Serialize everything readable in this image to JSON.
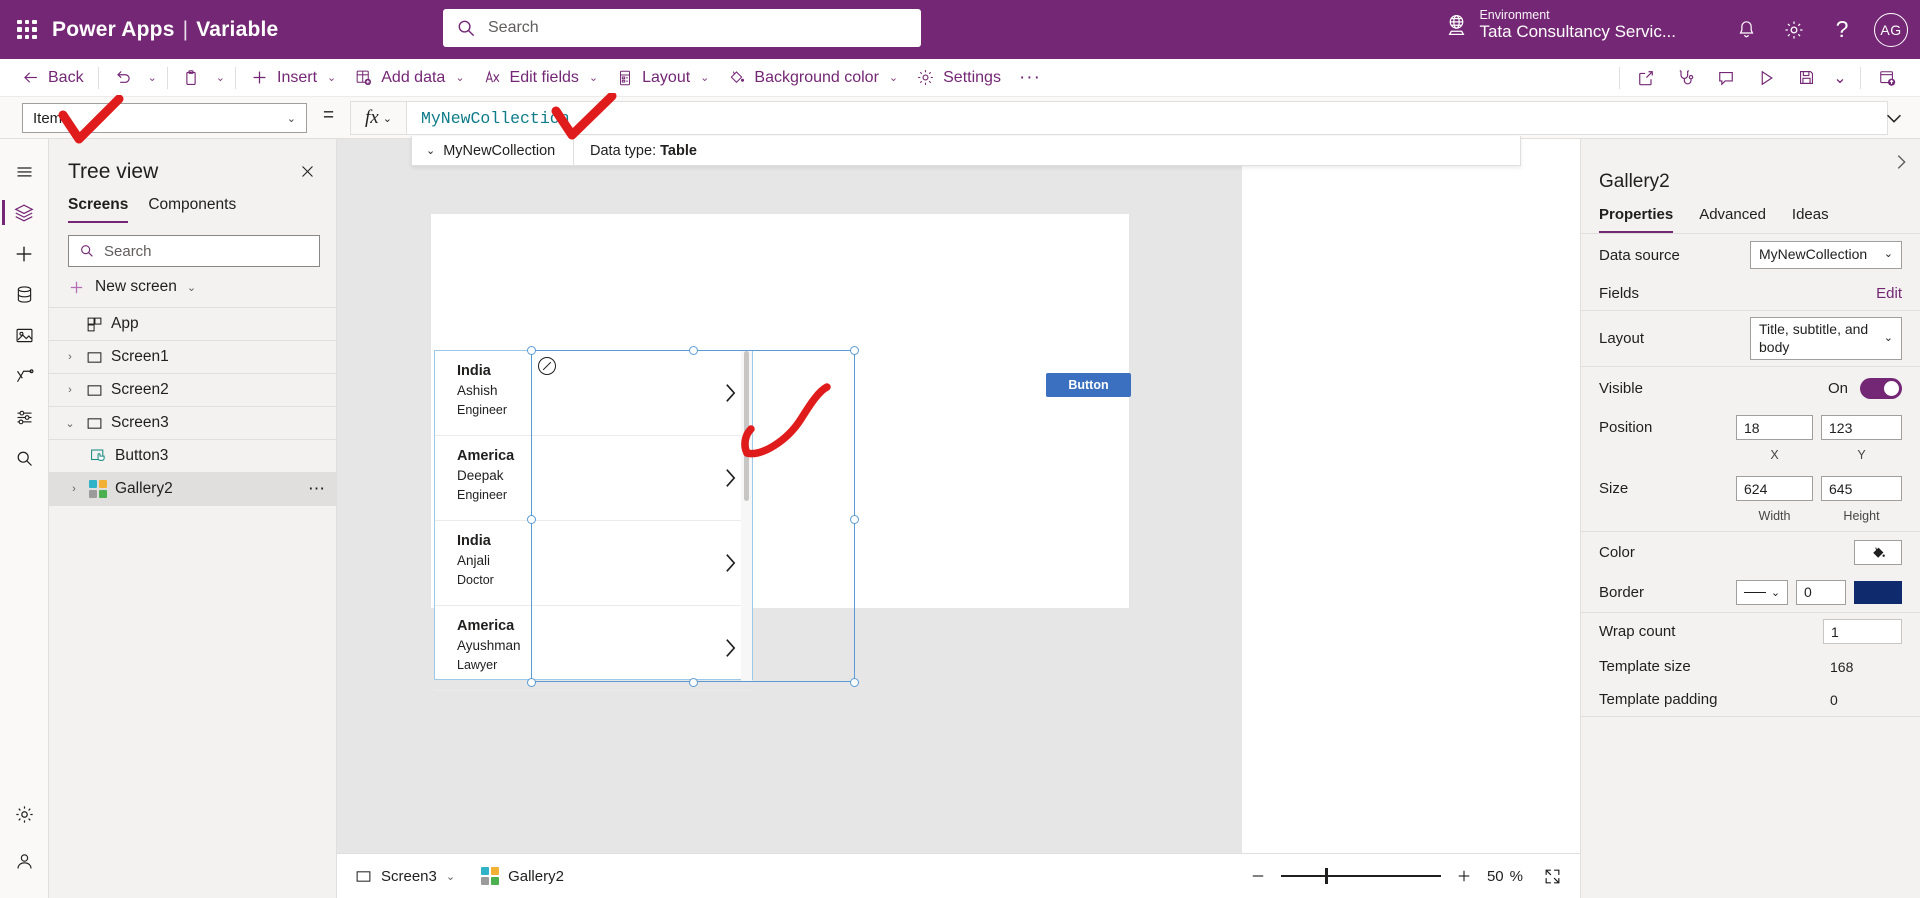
{
  "header": {
    "brand": "Power Apps",
    "separator": "|",
    "app_name": "Variable",
    "search_placeholder": "Search",
    "environment_label": "Environment",
    "environment_name": "Tata Consultancy Servic...",
    "avatar_initials": "AG",
    "accent_color": "#742774"
  },
  "commandbar": {
    "back": "Back",
    "insert": "Insert",
    "add_data": "Add data",
    "edit_fields": "Edit fields",
    "layout": "Layout",
    "background_color": "Background color",
    "settings": "Settings",
    "overflow": "···"
  },
  "formulabar": {
    "property": "Items",
    "equals": "=",
    "fx": "fx",
    "expression": "MyNewCollection",
    "expression_color": "#0f7c8a",
    "suggestion_name": "MyNewCollection",
    "datatype_label": "Data type:",
    "datatype_value": "Table"
  },
  "treeview": {
    "title": "Tree view",
    "tabs": [
      {
        "label": "Screens",
        "selected": true
      },
      {
        "label": "Components",
        "selected": false
      }
    ],
    "search_placeholder": "Search",
    "new_screen": "New screen",
    "items": [
      {
        "label": "App",
        "icon": "app-icon",
        "indent": 1,
        "caret": "",
        "selected": false
      },
      {
        "label": "Screen1",
        "icon": "screen-icon",
        "indent": 1,
        "caret": "›",
        "selected": false
      },
      {
        "label": "Screen2",
        "icon": "screen-icon",
        "indent": 1,
        "caret": "›",
        "selected": false
      },
      {
        "label": "Screen3",
        "icon": "screen-icon",
        "indent": 1,
        "caret": "⌄",
        "selected": false
      },
      {
        "label": "Button3",
        "icon": "button-icon",
        "indent": 2,
        "caret": "",
        "selected": false
      },
      {
        "label": "Gallery2",
        "icon": "gallery-icon",
        "indent": 2,
        "caret": "›",
        "selected": true,
        "overflow": "⋯"
      }
    ]
  },
  "canvas": {
    "button_label": "Button",
    "gallery_items": [
      {
        "title": "India",
        "subtitle": "Ashish",
        "body": "Engineer"
      },
      {
        "title": "America",
        "subtitle": "Deepak",
        "body": "Engineer"
      },
      {
        "title": "India",
        "subtitle": "Anjali",
        "body": "Doctor"
      },
      {
        "title": "America",
        "subtitle": "Ayushman",
        "body": "Lawyer"
      }
    ]
  },
  "properties": {
    "control_name": "Gallery2",
    "tabs": [
      {
        "label": "Properties",
        "selected": true
      },
      {
        "label": "Advanced",
        "selected": false
      },
      {
        "label": "Ideas",
        "selected": false
      }
    ],
    "data_source_label": "Data source",
    "data_source_value": "MyNewCollection",
    "fields_label": "Fields",
    "fields_edit": "Edit",
    "layout_label": "Layout",
    "layout_value": "Title, subtitle, and body",
    "visible_label": "Visible",
    "visible_state": "On",
    "position_label": "Position",
    "position_x": "18",
    "position_y": "123",
    "position_x_sub": "X",
    "position_y_sub": "Y",
    "size_label": "Size",
    "size_width": "624",
    "size_height": "645",
    "size_width_sub": "Width",
    "size_height_sub": "Height",
    "color_label": "Color",
    "border_label": "Border",
    "border_width": "0",
    "border_color": "#102a6e",
    "wrap_count_label": "Wrap count",
    "wrap_count_value": "1",
    "template_size_label": "Template size",
    "template_size_value": "168",
    "template_padding_label": "Template padding",
    "template_padding_value": "0"
  },
  "statusbar": {
    "screen_name": "Screen3",
    "control_name": "Gallery2",
    "zoom_value": "50",
    "zoom_unit": "%"
  }
}
